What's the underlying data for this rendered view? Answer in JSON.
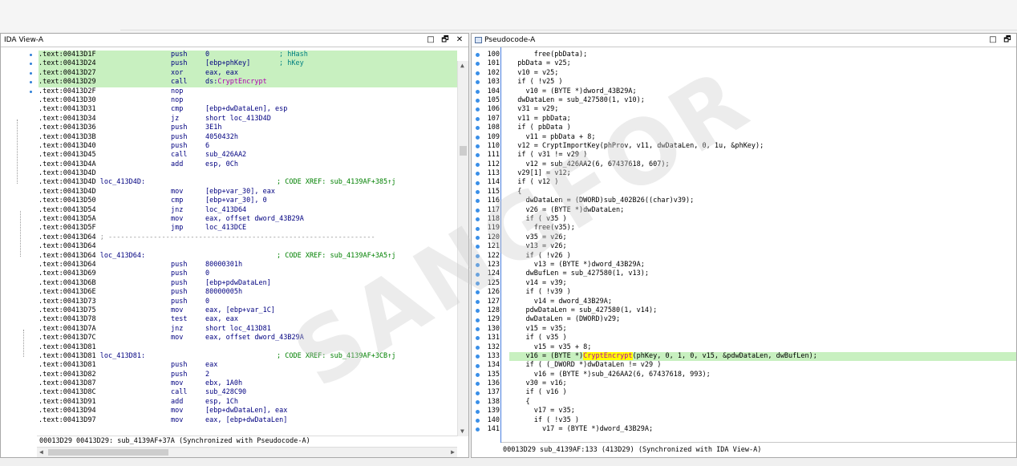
{
  "ida_view": {
    "title": "IDA View-A",
    "buttons": [
      "□",
      "🗗",
      "✕"
    ],
    "status": "00013D29 00413D29: sub_4139AF+37A (Synchronized with Pseudocode-A)",
    "lines": [
      {
        "addr": ".text:00413D1F",
        "mn": "push",
        "op": "0",
        "cm": "; hHash",
        "hl": true
      },
      {
        "addr": ".text:00413D24",
        "mn": "push",
        "op": "[ebp+phKey]",
        "cm": "; hKey",
        "hl": true
      },
      {
        "addr": ".text:00413D27",
        "mn": "xor",
        "op": "eax, eax",
        "cm": "",
        "hl": true
      },
      {
        "addr": ".text:00413D29",
        "mn": "call",
        "op": "ds:",
        "fn": "CryptEncrypt",
        "cm": "",
        "hl": true,
        "cur": true
      },
      {
        "addr": ".text:00413D2F",
        "mn": "nop",
        "op": "",
        "cm": ""
      },
      {
        "addr": ".text:00413D30",
        "mn": "nop",
        "op": "",
        "cm": ""
      },
      {
        "addr": ".text:00413D31",
        "mn": "cmp",
        "op": "[ebp+dwDataLen], esp",
        "cm": ""
      },
      {
        "addr": ".text:00413D34",
        "mn": "jz",
        "op": "short loc_413D4D",
        "cm": ""
      },
      {
        "addr": ".text:00413D36",
        "mn": "push",
        "op": "3E1h",
        "cm": ""
      },
      {
        "addr": ".text:00413D3B",
        "mn": "push",
        "op": "4050432h",
        "cm": ""
      },
      {
        "addr": ".text:00413D40",
        "mn": "push",
        "op": "6",
        "cm": ""
      },
      {
        "addr": ".text:00413D45",
        "mn": "call",
        "op": "sub_426AA2",
        "cm": ""
      },
      {
        "addr": ".text:00413D4A",
        "mn": "add",
        "op": "esp, 0Ch",
        "cm": ""
      },
      {
        "addr": ".text:00413D4D",
        "mn": "",
        "op": "",
        "cm": ""
      },
      {
        "addr": ".text:00413D4D",
        "label": "loc_413D4D:",
        "xref": "; CODE XREF: sub_4139AF+385↑j"
      },
      {
        "addr": ".text:00413D4D",
        "mn": "mov",
        "op": "[ebp+var_30], eax",
        "cm": ""
      },
      {
        "addr": ".text:00413D50",
        "mn": "cmp",
        "op": "[ebp+var_30], 0",
        "cm": ""
      },
      {
        "addr": ".text:00413D54",
        "mn": "jnz",
        "op": "loc_413D64",
        "cm": ""
      },
      {
        "addr": ".text:00413D5A",
        "mn": "mov",
        "op": "eax, offset dword_43B29A",
        "cm": ""
      },
      {
        "addr": ".text:00413D5F",
        "mn": "jmp",
        "op": "loc_413DCE",
        "cm": ""
      },
      {
        "addr": ".text:00413D64",
        "sep": "; -----------------------------------------------------------------"
      },
      {
        "addr": ".text:00413D64",
        "mn": "",
        "op": "",
        "cm": ""
      },
      {
        "addr": ".text:00413D64",
        "label": "loc_413D64:",
        "xref": "; CODE XREF: sub_4139AF+3A5↑j"
      },
      {
        "addr": ".text:00413D64",
        "mn": "push",
        "op": "80000301h",
        "cm": ""
      },
      {
        "addr": ".text:00413D69",
        "mn": "push",
        "op": "0",
        "cm": ""
      },
      {
        "addr": ".text:00413D6B",
        "mn": "push",
        "op": "[ebp+pdwDataLen]",
        "cm": ""
      },
      {
        "addr": ".text:00413D6E",
        "mn": "push",
        "op": "80000005h",
        "cm": ""
      },
      {
        "addr": ".text:00413D73",
        "mn": "push",
        "op": "0",
        "cm": ""
      },
      {
        "addr": ".text:00413D75",
        "mn": "mov",
        "op": "eax, [ebp+var_1C]",
        "cm": ""
      },
      {
        "addr": ".text:00413D78",
        "mn": "test",
        "op": "eax, eax",
        "cm": ""
      },
      {
        "addr": ".text:00413D7A",
        "mn": "jnz",
        "op": "short loc_413D81",
        "cm": ""
      },
      {
        "addr": ".text:00413D7C",
        "mn": "mov",
        "op": "eax, offset dword_43B29A",
        "cm": ""
      },
      {
        "addr": ".text:00413D81",
        "mn": "",
        "op": "",
        "cm": ""
      },
      {
        "addr": ".text:00413D81",
        "label": "loc_413D81:",
        "xref": "; CODE XREF: sub_4139AF+3CB↑j"
      },
      {
        "addr": ".text:00413D81",
        "mn": "push",
        "op": "eax",
        "cm": ""
      },
      {
        "addr": ".text:00413D82",
        "mn": "push",
        "op": "2",
        "cm": ""
      },
      {
        "addr": ".text:00413D87",
        "mn": "mov",
        "op": "ebx, 1A0h",
        "cm": ""
      },
      {
        "addr": ".text:00413D8C",
        "mn": "call",
        "op": "sub_428C90",
        "cm": ""
      },
      {
        "addr": ".text:00413D91",
        "mn": "add",
        "op": "esp, 1Ch",
        "cm": ""
      },
      {
        "addr": ".text:00413D94",
        "mn": "mov",
        "op": "[ebp+dwDataLen], eax",
        "cm": ""
      },
      {
        "addr": ".text:00413D97",
        "mn": "mov",
        "op": "eax, [ebp+dwDataLen]",
        "cm": ""
      }
    ]
  },
  "pseudocode": {
    "title": "Pseudocode-A",
    "buttons": [
      "□",
      "🗗"
    ],
    "status": "00013D29 sub_4139AF:133 (413D29) (Synchronized with IDA View-A)",
    "lines": [
      {
        "n": "100",
        "t": "      free(pbData);"
      },
      {
        "n": "101",
        "t": "  pbData = v25;"
      },
      {
        "n": "102",
        "t": "  v10 = v25;"
      },
      {
        "n": "103",
        "t": "  if ( !v25 )"
      },
      {
        "n": "104",
        "t": "    v10 = (BYTE *)dword_43B29A;"
      },
      {
        "n": "105",
        "t": "  dwDataLen = sub_427580(1, v10);"
      },
      {
        "n": "106",
        "t": "  v31 = v29;"
      },
      {
        "n": "107",
        "t": "  v11 = pbData;"
      },
      {
        "n": "108",
        "t": "  if ( pbData )"
      },
      {
        "n": "109",
        "t": "    v11 = pbData + 8;"
      },
      {
        "n": "110",
        "t": "  v12 = CryptImportKey(phProv, v11, dwDataLen, 0, 1u, &phKey);"
      },
      {
        "n": "111",
        "t": "  if ( v31 != v29 )"
      },
      {
        "n": "112",
        "t": "    v12 = sub_426AA2(6, 67437618, 607);"
      },
      {
        "n": "113",
        "t": "  v29[1] = v12;"
      },
      {
        "n": "114",
        "t": "  if ( v12 )"
      },
      {
        "n": "115",
        "t": "  {"
      },
      {
        "n": "116",
        "t": "    dwDataLen = (DWORD)sub_402B26((char)v39);"
      },
      {
        "n": "117",
        "t": "    v26 = (BYTE *)dwDataLen;"
      },
      {
        "n": "118",
        "t": "    if ( v35 )"
      },
      {
        "n": "119",
        "t": "      free(v35);"
      },
      {
        "n": "120",
        "t": "    v35 = v26;"
      },
      {
        "n": "121",
        "t": "    v13 = v26;"
      },
      {
        "n": "122",
        "t": "    if ( !v26 )"
      },
      {
        "n": "123",
        "t": "      v13 = (BYTE *)dword_43B29A;"
      },
      {
        "n": "124",
        "t": "    dwBufLen = sub_427580(1, v13);"
      },
      {
        "n": "125",
        "t": "    v14 = v39;"
      },
      {
        "n": "126",
        "t": "    if ( !v39 )"
      },
      {
        "n": "127",
        "t": "      v14 = dword_43B29A;"
      },
      {
        "n": "128",
        "t": "    pdwDataLen = sub_427580(1, v14);"
      },
      {
        "n": "129",
        "t": "    dwDataLen = (DWORD)v29;"
      },
      {
        "n": "130",
        "t": "    v15 = v35;"
      },
      {
        "n": "131",
        "t": "    if ( v35 )"
      },
      {
        "n": "132",
        "t": "      v15 = v35 + 8;"
      },
      {
        "n": "133",
        "t_pre": "    v16 = (BYTE *)",
        "t_fn": "CryptEncrypt",
        "t_post": "(phKey, 0, 1, 0, v15, &pdwDataLen, dwBufLen);",
        "hl": true
      },
      {
        "n": "134",
        "t": "    if ( (_DWORD *)dwDataLen != v29 )"
      },
      {
        "n": "135",
        "t": "      v16 = (BYTE *)sub_426AA2(6, 67437618, 993);"
      },
      {
        "n": "136",
        "t": "    v30 = v16;"
      },
      {
        "n": "137",
        "t": "    if ( v16 )"
      },
      {
        "n": "138",
        "t": "    {"
      },
      {
        "n": "139",
        "t": "      v17 = v35;"
      },
      {
        "n": "140",
        "t": "      if ( !v35 )"
      },
      {
        "n": "141",
        "t": "        v17 = (BYTE *)dword_43B29A;"
      }
    ]
  },
  "watermark": "SANGFOR",
  "colors": {
    "highlight": "#c8f0c0",
    "mnemonic": "#000080",
    "xref": "#008000",
    "api": "#b000b0",
    "cursor": "#ffff00",
    "accent": "#3a8fe8"
  }
}
